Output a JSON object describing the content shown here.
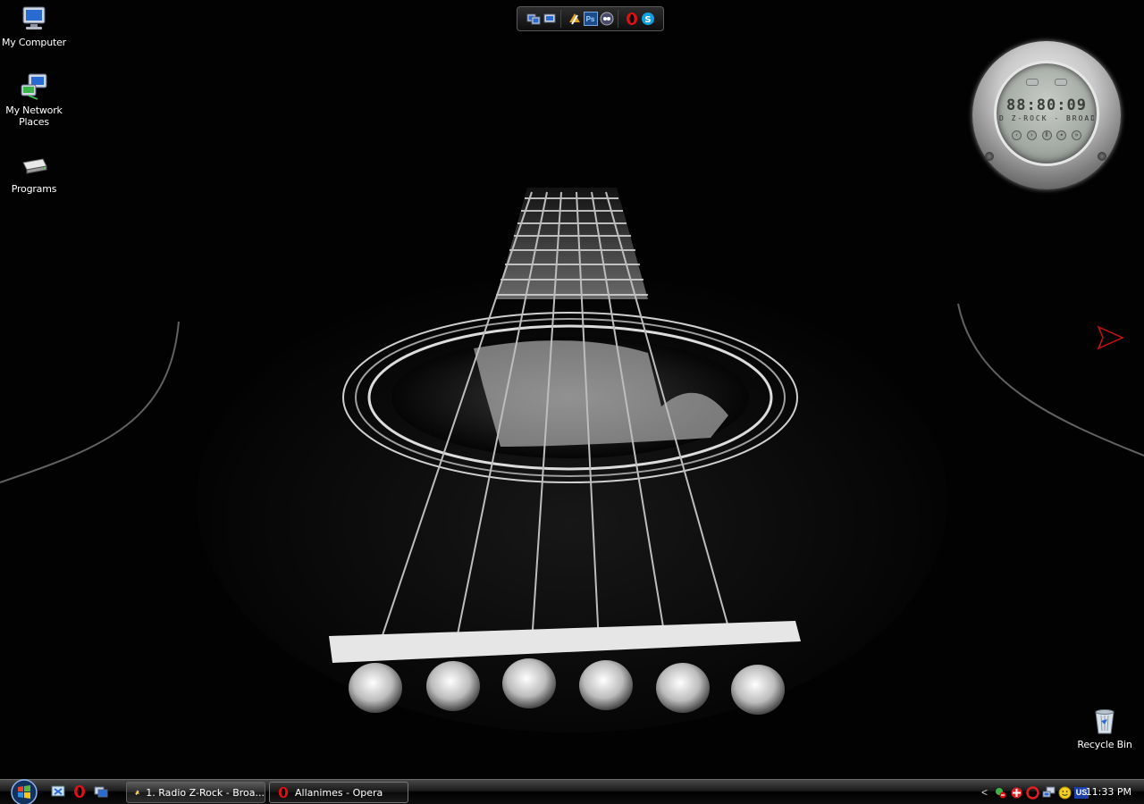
{
  "desktop": {
    "icons": [
      {
        "label": "My Computer",
        "icon": "my-computer-icon"
      },
      {
        "label": "My Network Places",
        "icon": "network-places-icon"
      },
      {
        "label": "Programs",
        "icon": "programs-drive-icon"
      },
      {
        "label": "Recycle Bin",
        "icon": "recycle-bin-icon"
      }
    ]
  },
  "dock": {
    "items": [
      "windows-explorer-icon",
      "winamp-icon",
      "photoshop-icon",
      "messenger-icon",
      "opera-icon",
      "skype-icon"
    ],
    "photoshop_label": "Ps"
  },
  "player": {
    "time": "88:80:09",
    "scrolling_text": "D Z-ROCK - BROADCAST",
    "controls": [
      "prev",
      "play",
      "pause",
      "stop",
      "next"
    ]
  },
  "taskbar": {
    "start_icon": "windows-start-orb",
    "quick_launch": [
      "show-desktop-icon",
      "opera-icon",
      "switch-windows-icon"
    ],
    "tasks": [
      {
        "label": "1. Radio Z-Rock - Broa...",
        "icon": "winamp-icon",
        "active": false
      },
      {
        "label": "Allanimes - Opera",
        "icon": "opera-icon",
        "active": true
      }
    ],
    "tray": {
      "expand_label": "<",
      "icons": [
        "messenger-status-icon",
        "antivirus-icon",
        "opera-mail-icon",
        "network-icon",
        "smiley-icon"
      ],
      "language": "US",
      "clock": "11:33 PM"
    }
  },
  "colors": {
    "taskbar_bg": "#1b1b1b",
    "accent_red": "#cc1111",
    "lang_bg": "#1b3fa8"
  }
}
